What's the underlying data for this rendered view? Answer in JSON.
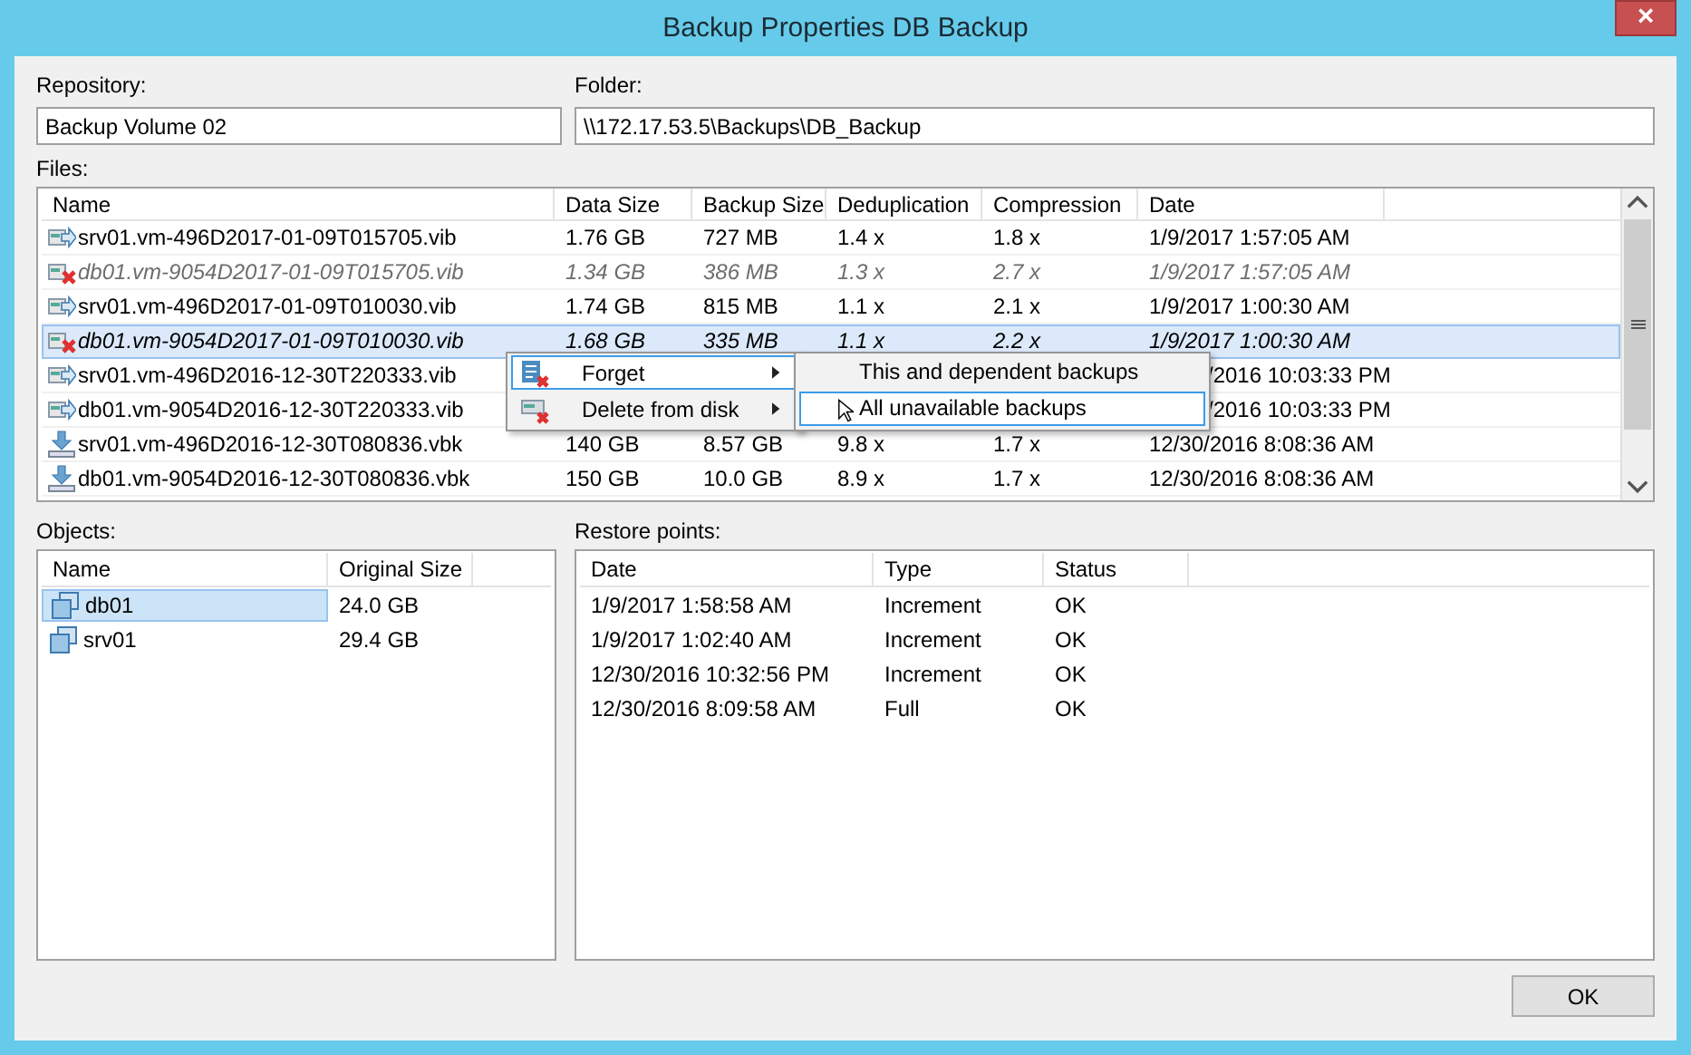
{
  "window": {
    "title": "Backup Properties DB Backup",
    "close": "×"
  },
  "repository": {
    "label": "Repository:",
    "value": "Backup Volume 02"
  },
  "folder": {
    "label": "Folder:",
    "value": "\\\\172.17.53.5\\Backups\\DB_Backup"
  },
  "files": {
    "label": "Files:",
    "columns": [
      "Name",
      "Data Size",
      "Backup Size",
      "Deduplication",
      "Compression",
      "Date"
    ],
    "rows": [
      {
        "kind": "increment",
        "selected": false,
        "cells": [
          "srv01.vm-496D2017-01-09T015705.vib",
          "1.76 GB",
          "727 MB",
          "1.4 x",
          "1.8 x",
          "1/9/2017 1:57:05 AM"
        ]
      },
      {
        "kind": "missing",
        "selected": false,
        "cells": [
          "db01.vm-9054D2017-01-09T015705.vib",
          "1.34 GB",
          "386 MB",
          "1.3 x",
          "2.7 x",
          "1/9/2017 1:57:05 AM"
        ]
      },
      {
        "kind": "increment",
        "selected": false,
        "cells": [
          "srv01.vm-496D2017-01-09T010030.vib",
          "1.74 GB",
          "815 MB",
          "1.1 x",
          "2.1 x",
          "1/9/2017 1:00:30 AM"
        ]
      },
      {
        "kind": "missing",
        "selected": true,
        "cells": [
          "db01.vm-9054D2017-01-09T010030.vib",
          "1.68 GB",
          "335 MB",
          "1.1 x",
          "2.2 x",
          "1/9/2017 1:00:30 AM"
        ]
      },
      {
        "kind": "increment",
        "selected": false,
        "covered": true,
        "cells": [
          "srv01.vm-496D2016-12-30T220333.vib",
          "",
          "",
          "",
          "",
          "/2016 10:03:33 PM"
        ]
      },
      {
        "kind": "increment",
        "selected": false,
        "covered": true,
        "cells": [
          "db01.vm-9054D2016-12-30T220333.vib",
          "",
          "",
          "",
          "",
          "/2016 10:03:33 PM"
        ]
      },
      {
        "kind": "full",
        "selected": false,
        "cells": [
          "srv01.vm-496D2016-12-30T080836.vbk",
          "140 GB",
          "8.57 GB",
          "9.8 x",
          "1.7 x",
          "12/30/2016 8:08:36 AM"
        ]
      },
      {
        "kind": "full",
        "selected": false,
        "cells": [
          "db01.vm-9054D2016-12-30T080836.vbk",
          "150 GB",
          "10.0 GB",
          "8.9 x",
          "1.7 x",
          "12/30/2016 8:08:36 AM"
        ]
      }
    ]
  },
  "context_menu": {
    "items": [
      {
        "label": "Forget",
        "kind": "forget",
        "selected": true
      },
      {
        "label": "Delete from disk",
        "kind": "delete",
        "selected": false
      }
    ],
    "submenu": [
      {
        "label": "This and dependent backups",
        "selected": false
      },
      {
        "label": "All unavailable backups",
        "selected": true
      }
    ]
  },
  "objects": {
    "label": "Objects:",
    "columns": [
      "Name",
      "Original Size"
    ],
    "rows": [
      {
        "name": "db01",
        "size": "24.0 GB",
        "selected": true
      },
      {
        "name": "srv01",
        "size": "29.4 GB",
        "selected": false
      }
    ]
  },
  "restore_points": {
    "label": "Restore points:",
    "columns": [
      "Date",
      "Type",
      "Status"
    ],
    "rows": [
      [
        "1/9/2017 1:58:58 AM",
        "Increment",
        "OK"
      ],
      [
        "1/9/2017 1:02:40 AM",
        "Increment",
        "OK"
      ],
      [
        "12/30/2016 10:32:56 PM",
        "Increment",
        "OK"
      ],
      [
        "12/30/2016 8:09:58 AM",
        "Full",
        "OK"
      ]
    ]
  },
  "buttons": [
    "OK"
  ]
}
